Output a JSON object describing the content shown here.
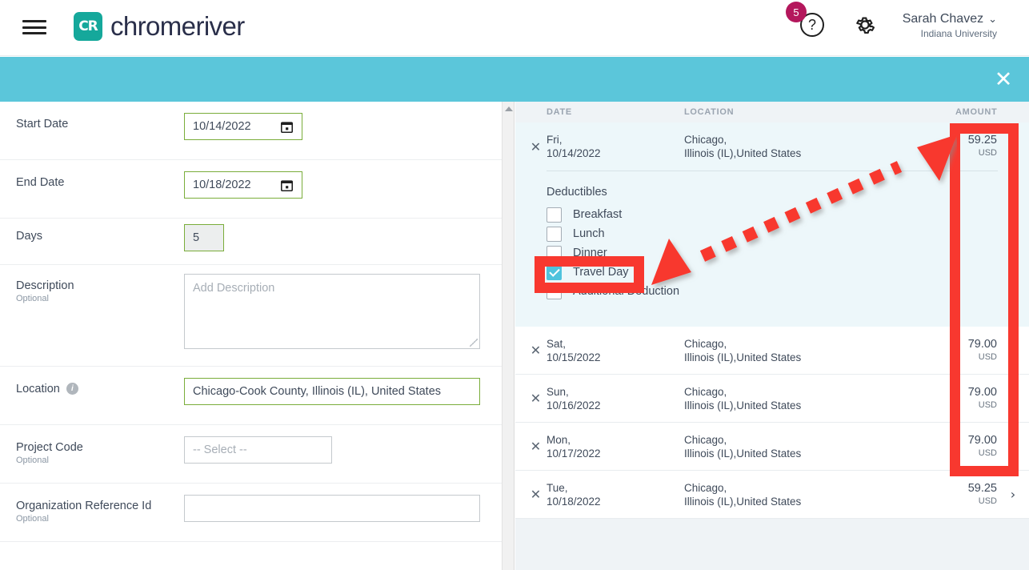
{
  "header": {
    "menu_icon": "hamburger-icon",
    "logo_mark": "CR",
    "logo_text": "chromeriver",
    "notification_count": "5",
    "help_icon": "?",
    "gear_icon": "gear-icon",
    "user_name": "Sarah Chavez",
    "user_caret": "⌄",
    "user_org": "Indiana University"
  },
  "banner": {
    "close_label": "✕",
    "color": "#5bc6da"
  },
  "form": {
    "rows": [
      {
        "label": "Start Date",
        "optional": "",
        "value": "10/14/2022",
        "kind": "date"
      },
      {
        "label": "End Date",
        "optional": "",
        "value": "10/18/2022",
        "kind": "date"
      },
      {
        "label": "Days",
        "optional": "",
        "value": "5",
        "kind": "days"
      },
      {
        "label": "Description",
        "optional": "Optional",
        "value": "",
        "placeholder": "Add Description",
        "kind": "textarea"
      },
      {
        "label": "Location",
        "optional": "",
        "value": "Chicago-Cook County, Illinois (IL), United States",
        "kind": "location"
      },
      {
        "label": "Project Code",
        "optional": "Optional",
        "value": "-- Select --",
        "kind": "select"
      },
      {
        "label": "Organization Reference Id",
        "optional": "Optional",
        "value": "",
        "kind": "text"
      }
    ]
  },
  "table": {
    "headers": {
      "date": "DATE",
      "location": "LOCATION",
      "amount": "AMOUNT"
    },
    "remove_icon": "✕",
    "rows": [
      {
        "day": "Fri,",
        "date": "10/14/2022",
        "city": "Chicago,",
        "region": "Illinois (IL),United States",
        "amount": "59.25",
        "currency": "USD",
        "chevron": "⌄",
        "expanded": true,
        "deductibles_title": "Deductibles",
        "deductibles": [
          {
            "label": "Breakfast",
            "checked": false
          },
          {
            "label": "Lunch",
            "checked": false
          },
          {
            "label": "Dinner",
            "checked": false
          },
          {
            "label": "Travel Day",
            "checked": true
          },
          {
            "label": "Additional Deduction",
            "checked": false
          }
        ]
      },
      {
        "day": "Sat,",
        "date": "10/15/2022",
        "city": "Chicago,",
        "region": "Illinois (IL),United States",
        "amount": "79.00",
        "currency": "USD",
        "chevron": "›",
        "expanded": false
      },
      {
        "day": "Sun,",
        "date": "10/16/2022",
        "city": "Chicago,",
        "region": "Illinois (IL),United States",
        "amount": "79.00",
        "currency": "USD",
        "chevron": "›",
        "expanded": false
      },
      {
        "day": "Mon,",
        "date": "10/17/2022",
        "city": "Chicago,",
        "region": "Illinois (IL),United States",
        "amount": "79.00",
        "currency": "USD",
        "chevron": "›",
        "expanded": false
      },
      {
        "day": "Tue,",
        "date": "10/18/2022",
        "city": "Chicago,",
        "region": "Illinois (IL),United States",
        "amount": "59.25",
        "currency": "USD",
        "chevron": "›",
        "expanded": false
      }
    ]
  },
  "annotations": {
    "highlight_color": "#f8382f",
    "travel_day_box": "Travel Day checkbox highlight",
    "amount_column_box": "Amount column highlight",
    "arrow": "dashed double arrow from Travel Day to Amount"
  }
}
